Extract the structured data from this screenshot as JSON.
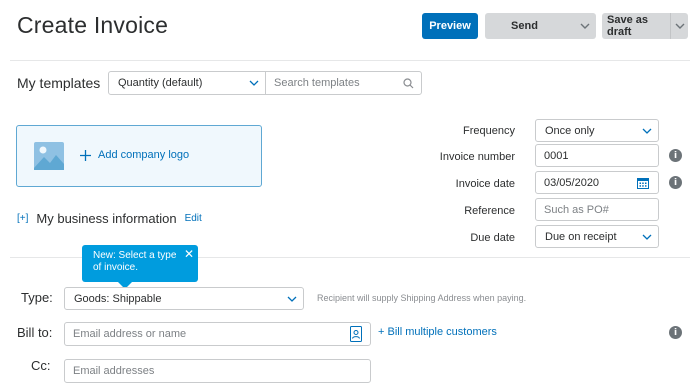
{
  "header": {
    "title": "Create Invoice",
    "preview_label": "Preview",
    "send_label": "Send",
    "save_draft_label": "Save as draft"
  },
  "templates": {
    "label": "My templates",
    "selected": "Quantity (default)",
    "search_placeholder": "Search templates"
  },
  "logo": {
    "add_label": "Add company logo"
  },
  "business": {
    "expand_label": "[+]",
    "title": "My business information",
    "edit_label": "Edit"
  },
  "details": {
    "frequency_label": "Frequency",
    "frequency_value": "Once only",
    "invoice_number_label": "Invoice number",
    "invoice_number_value": "0001",
    "invoice_date_label": "Invoice date",
    "invoice_date_value": "03/05/2020",
    "reference_label": "Reference",
    "reference_placeholder": "Such as PO#",
    "due_date_label": "Due date",
    "due_date_value": "Due on receipt"
  },
  "tooltip": {
    "text": "New: Select a type of invoice.",
    "close": "✕"
  },
  "form": {
    "type_label": "Type:",
    "type_value": "Goods: Shippable",
    "type_hint": "Recipient will supply Shipping Address when paying.",
    "bill_to_label": "Bill to:",
    "bill_to_placeholder": "Email address or name",
    "bill_multiple_label": "+ Bill multiple customers",
    "cc_label": "Cc:",
    "cc_placeholder": "Email addresses"
  },
  "icons": {
    "info": "i"
  },
  "colors": {
    "primary": "#0070ba",
    "tooltip": "#009cde",
    "button_grey": "#d6d8da"
  }
}
